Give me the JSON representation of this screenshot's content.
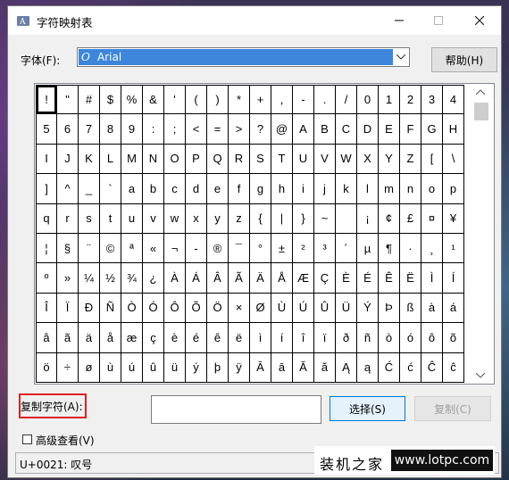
{
  "window": {
    "title": "字符映射表"
  },
  "font_row": {
    "label": "字体(F):",
    "selected_font": "Arial",
    "font_icon_glyph": "O",
    "help_button": "帮助(H)"
  },
  "char_grid": {
    "rows": [
      [
        "!",
        "\"",
        "#",
        "$",
        "%",
        "&",
        "'",
        "(",
        ")",
        "*",
        "+",
        ",",
        "-",
        ".",
        "/",
        "0",
        "1",
        "2",
        "3",
        "4"
      ],
      [
        "5",
        "6",
        "7",
        "8",
        "9",
        ":",
        ";",
        "<",
        "=",
        ">",
        "?",
        "@",
        "A",
        "B",
        "C",
        "D",
        "E",
        "F",
        "G",
        "H"
      ],
      [
        "I",
        "J",
        "K",
        "L",
        "M",
        "N",
        "O",
        "P",
        "Q",
        "R",
        "S",
        "T",
        "U",
        "V",
        "W",
        "X",
        "Y",
        "Z",
        "[",
        "\\"
      ],
      [
        "]",
        "^",
        "_",
        "`",
        "a",
        "b",
        "c",
        "d",
        "e",
        "f",
        "g",
        "h",
        "i",
        "j",
        "k",
        "l",
        "m",
        "n",
        "o",
        "p"
      ],
      [
        "q",
        "r",
        "s",
        "t",
        "u",
        "v",
        "w",
        "x",
        "y",
        "z",
        "{",
        "|",
        "}",
        "~",
        " ",
        "¡",
        "¢",
        "£",
        "¤",
        "¥"
      ],
      [
        "¦",
        "§",
        "¨",
        "©",
        "ª",
        "«",
        "¬",
        "-",
        "®",
        "¯",
        "°",
        "±",
        "²",
        "³",
        "´",
        "µ",
        "¶",
        "·",
        "¸",
        "¹"
      ],
      [
        "º",
        "»",
        "¼",
        "½",
        "¾",
        "¿",
        "À",
        "Á",
        "Â",
        "Ã",
        "Ä",
        "Å",
        "Æ",
        "Ç",
        "È",
        "É",
        "Ê",
        "Ë",
        "Ì",
        "Í"
      ],
      [
        "Î",
        "Ï",
        "Ð",
        "Ñ",
        "Ò",
        "Ó",
        "Ô",
        "Õ",
        "Ö",
        "×",
        "Ø",
        "Ù",
        "Ú",
        "Û",
        "Ü",
        "Ý",
        "Þ",
        "ß",
        "à",
        "á"
      ],
      [
        "â",
        "ã",
        "ä",
        "å",
        "æ",
        "ç",
        "è",
        "é",
        "ê",
        "ë",
        "ì",
        "í",
        "î",
        "ï",
        "ð",
        "ñ",
        "ò",
        "ó",
        "ô",
        "õ"
      ],
      [
        "ö",
        "÷",
        "ø",
        "ù",
        "ú",
        "û",
        "ü",
        "ý",
        "þ",
        "ÿ",
        "Ā",
        "ā",
        "Ă",
        "ă",
        "Ą",
        "ą",
        "Ć",
        "ć",
        "Ĉ",
        "ĉ"
      ]
    ],
    "selected_char": "!"
  },
  "copy_row": {
    "label": "复制字符(A):",
    "value": "",
    "select_button": "选择(S)",
    "copy_button": "复制(C)"
  },
  "advanced": {
    "label": "高级查看(V)",
    "checked": false
  },
  "status": {
    "text": "U+0021: 叹号"
  },
  "watermark": {
    "cn": "装机之家",
    "url": "www.lotpc.com"
  }
}
